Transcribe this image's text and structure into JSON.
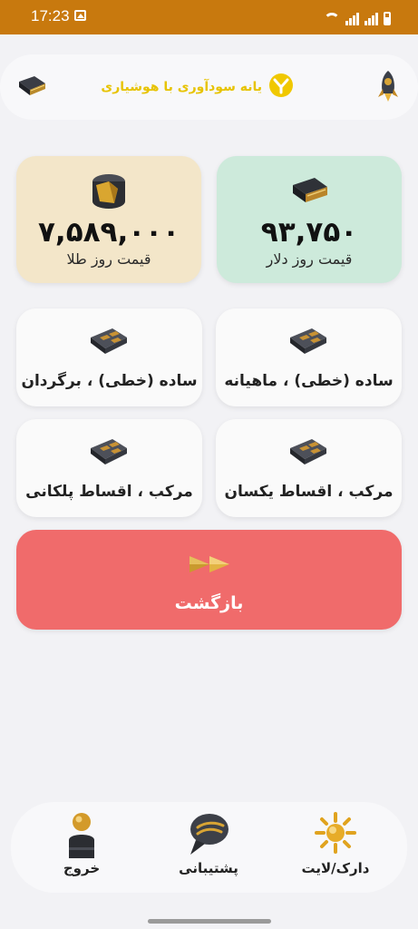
{
  "status_bar": {
    "time": "17:23"
  },
  "header": {
    "app_title": "یانه سودآوری با هوشیاری"
  },
  "rates": {
    "gold": {
      "value": "۷,۵۸۹,۰۰۰",
      "label": "قیمت روز طلا"
    },
    "dollar": {
      "value": "۹۳,۷۵۰",
      "label": "قیمت روز دلار"
    }
  },
  "calculators": {
    "simple_monthly": "ساده (خطی) ، ماهیانه",
    "simple_return": "ساده (خطی) ، برگردان",
    "compound_equal": "مرکب ، اقساط یکسان",
    "compound_step": "مرکب ، اقساط پلکانی"
  },
  "back_button": {
    "label": "بازگشت"
  },
  "bottom_nav": {
    "theme": "دارک/لایت",
    "support": "پشتیبانی",
    "exit": "خروج"
  },
  "icons": [
    "book-icon",
    "rocket-icon",
    "logo-icon",
    "gold-ingot-icon",
    "wallet-icon",
    "calculator-icon",
    "fast-forward-icon",
    "sun-icon",
    "chat-icon",
    "user-icon"
  ]
}
